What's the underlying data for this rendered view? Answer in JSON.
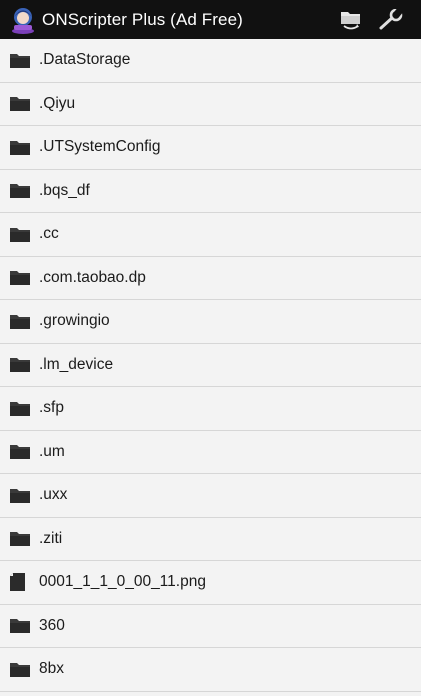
{
  "appbar": {
    "title": "ONScripter Plus (Ad Free)",
    "app_icon": "onscripter-app-icon",
    "actions": [
      {
        "icon": "folder-refresh-icon"
      },
      {
        "icon": "wrench-icon"
      }
    ]
  },
  "files": [
    {
      "name": ".DataStorage",
      "type": "folder"
    },
    {
      "name": ".Qiyu",
      "type": "folder"
    },
    {
      "name": ".UTSystemConfig",
      "type": "folder"
    },
    {
      "name": ".bqs_df",
      "type": "folder"
    },
    {
      "name": ".cc",
      "type": "folder"
    },
    {
      "name": ".com.taobao.dp",
      "type": "folder"
    },
    {
      "name": ".growingio",
      "type": "folder"
    },
    {
      "name": ".lm_device",
      "type": "folder"
    },
    {
      "name": ".sfp",
      "type": "folder"
    },
    {
      "name": ".um",
      "type": "folder"
    },
    {
      "name": ".uxx",
      "type": "folder"
    },
    {
      "name": ".ziti",
      "type": "folder"
    },
    {
      "name": "0001_1_1_0_00_11.png",
      "type": "file"
    },
    {
      "name": "360",
      "type": "folder"
    },
    {
      "name": "8bx",
      "type": "folder"
    }
  ],
  "colors": {
    "appbar_bg": "#111111",
    "list_bg": "#f3f3f3",
    "divider": "#d6d6d6",
    "icon": "#333333"
  }
}
